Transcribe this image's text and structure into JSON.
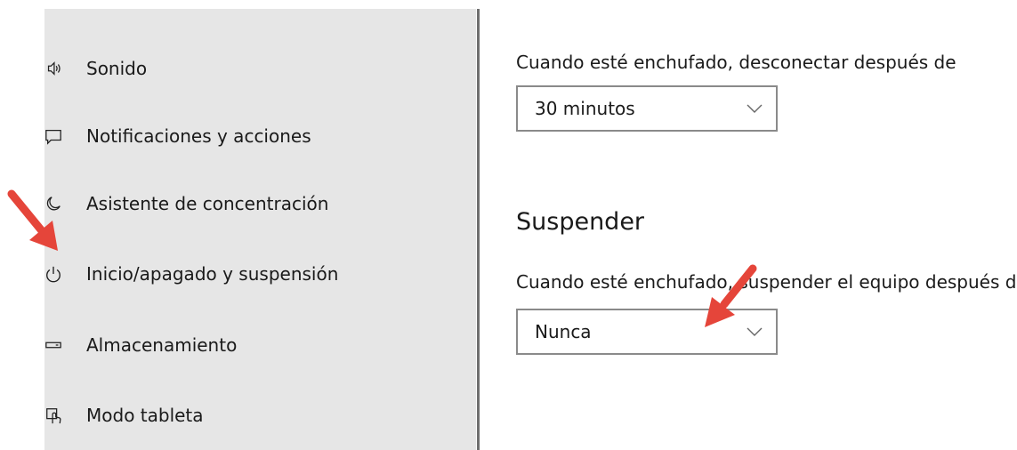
{
  "sidebar": {
    "items": [
      {
        "label": "Sonido",
        "icon": "speaker-icon"
      },
      {
        "label": "Notificaciones y acciones",
        "icon": "notification-icon"
      },
      {
        "label": "Asistente de concentración",
        "icon": "moon-icon"
      },
      {
        "label": "Inicio/apagado y suspensión",
        "icon": "power-icon"
      },
      {
        "label": "Almacenamiento",
        "icon": "storage-icon"
      },
      {
        "label": "Modo tableta",
        "icon": "tablet-mode-icon"
      }
    ]
  },
  "main": {
    "screen_label": "Cuando esté enchufado, desconectar después de",
    "screen_value": "30 minutos",
    "sleep_heading": "Suspender",
    "sleep_label": "Cuando esté enchufado, suspender el equipo después de",
    "sleep_value": "Nunca"
  },
  "annotations": {
    "arrow_color": "#e5453a"
  }
}
